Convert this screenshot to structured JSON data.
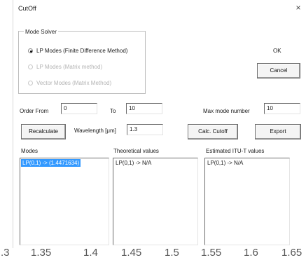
{
  "window": {
    "title": "CutOff",
    "close_glyph": "×"
  },
  "mode_solver": {
    "legend": "Mode Solver",
    "options": [
      {
        "label": "LP Modes (Finite Difference Method)",
        "selected": true,
        "enabled": true
      },
      {
        "label": "LP Modes (Matrix method)",
        "selected": false,
        "enabled": false
      },
      {
        "label": "Vector Modes (Matrix Method)",
        "selected": false,
        "enabled": false
      }
    ]
  },
  "buttons": {
    "ok": "OK",
    "cancel": "Cancel",
    "recalculate": "Recalculate",
    "calc_cutoff": "Calc. Cutoff",
    "export": "Export"
  },
  "fields": {
    "order_from_label": "Order From",
    "order_from_value": "0",
    "to_label": "To",
    "to_value": "10",
    "max_mode_label": "Max mode number",
    "max_mode_value": "10",
    "wavelength_label": "Wavelength [μm]",
    "wavelength_value": "1.3"
  },
  "lists": {
    "modes_header": "Modes",
    "theoretical_header": "Theoretical values",
    "itu_header": "Estimated ITU-T values",
    "modes_items": [
      "LP(0,1) -> (1.4471634)"
    ],
    "theoretical_items": [
      "LP(0,1) -> N/A"
    ],
    "itu_items": [
      "LP(0,1) -> N/A"
    ]
  },
  "background_axis": {
    "ticks": [
      ".3",
      "1.35",
      "1.4",
      "1.45",
      "1.5",
      "1.55",
      "1.6",
      "1.65"
    ]
  }
}
